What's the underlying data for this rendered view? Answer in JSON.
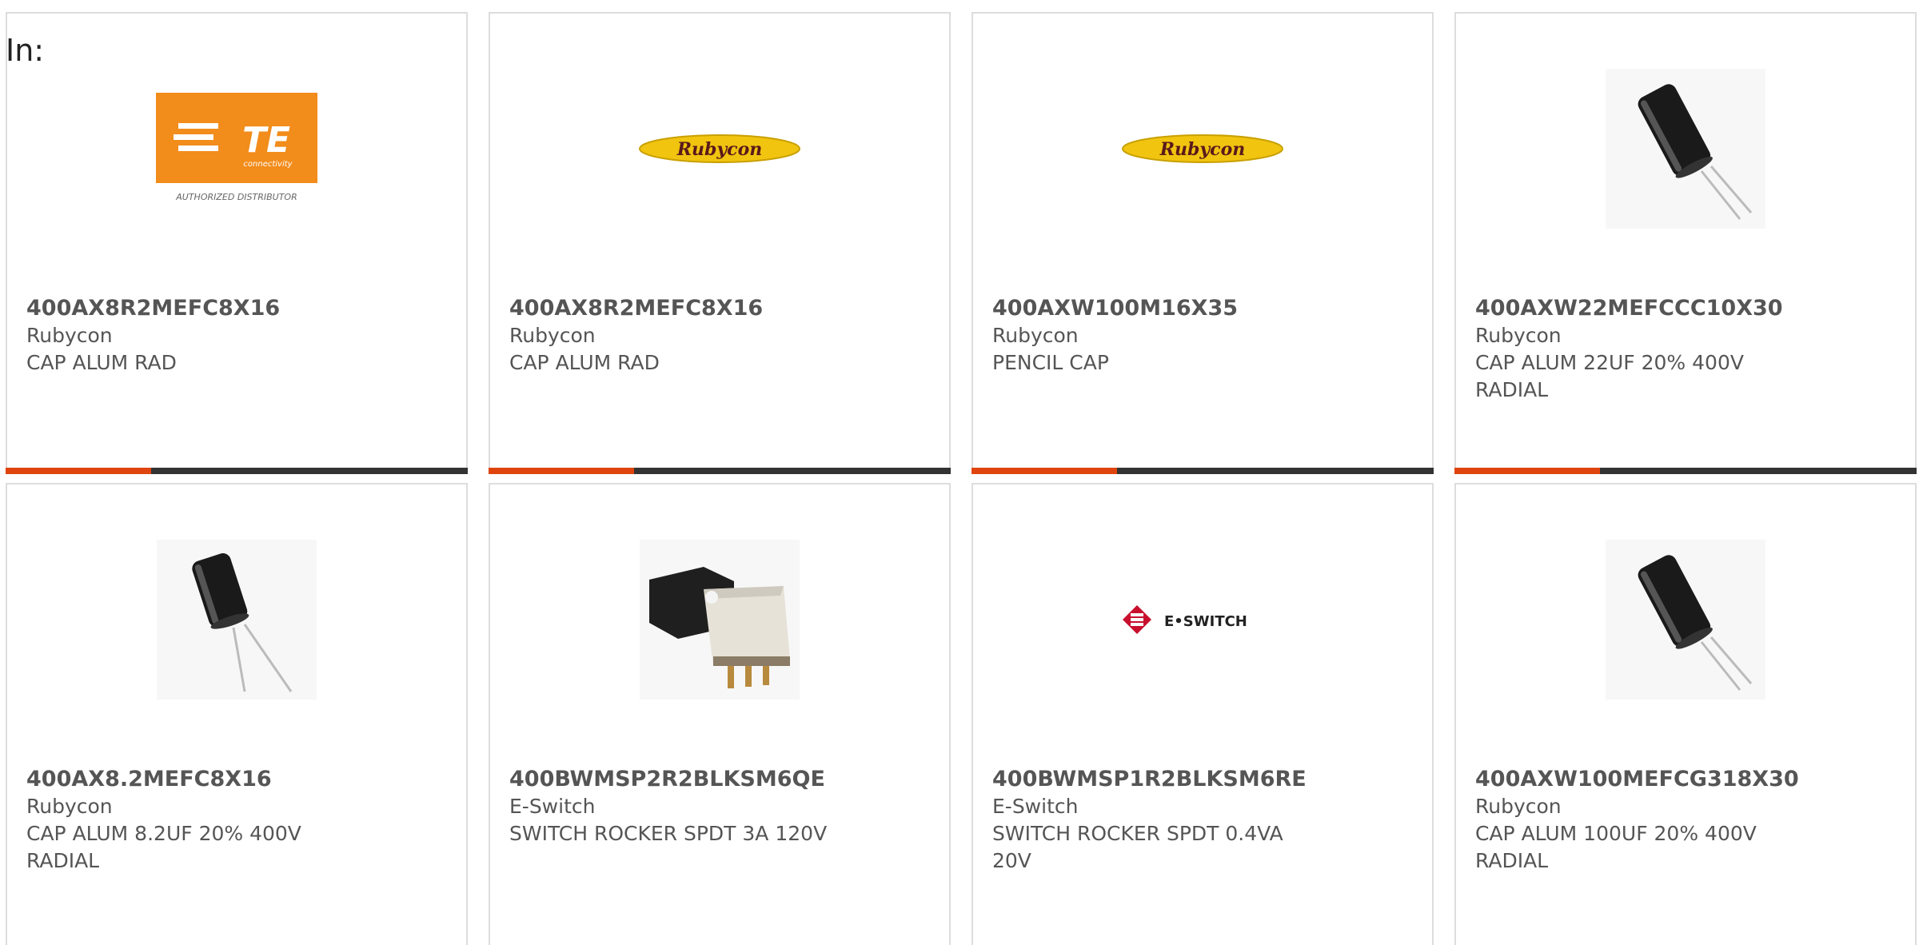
{
  "filter_label": "In:",
  "colors": {
    "accent": "#e0440e",
    "bar": "#333333",
    "text": "#555555",
    "te_orange": "#f28c1b",
    "rubycon_yellow": "#f1c40f",
    "eswitch_red": "#c8102e"
  },
  "products": [
    {
      "image": "te-logo-icon",
      "logo_text": "TE",
      "logo_sub": "connectivity",
      "logo_caption": "AUTHORIZED DISTRIBUTOR",
      "mpn": "400AX8R2MEFC8X16",
      "manufacturer": "Rubycon",
      "description": "CAP ALUM RAD"
    },
    {
      "image": "rubycon-logo-icon",
      "logo_text": "Rubycon",
      "mpn": "400AX8R2MEFC8X16",
      "manufacturer": "Rubycon",
      "description": "CAP ALUM RAD"
    },
    {
      "image": "rubycon-logo-icon",
      "logo_text": "Rubycon",
      "mpn": "400AXW100M16X35",
      "manufacturer": "Rubycon",
      "description": "PENCIL CAP"
    },
    {
      "image": "capacitor-icon",
      "mpn": "400AXW22MEFCCC10X30",
      "manufacturer": "Rubycon",
      "description": "CAP ALUM 22UF 20% 400V RADIAL"
    },
    {
      "image": "capacitor-icon",
      "mpn": "400AX8.2MEFC8X16",
      "manufacturer": "Rubycon",
      "description": "CAP ALUM 8.2UF 20% 400V RADIAL"
    },
    {
      "image": "rocker-switch-icon",
      "mpn": "400BWMSP2R2BLKSM6QE",
      "manufacturer": "E-Switch",
      "description": "SWITCH ROCKER SPDT 3A 120V"
    },
    {
      "image": "eswitch-logo-icon",
      "logo_text": "E•SWITCH",
      "mpn": "400BWMSP1R2BLKSM6RE",
      "manufacturer": "E-Switch",
      "description": "SWITCH ROCKER SPDT 0.4VA 20V"
    },
    {
      "image": "capacitor-icon",
      "mpn": "400AXW100MEFCG318X30",
      "manufacturer": "Rubycon",
      "description": "CAP ALUM 100UF 20% 400V RADIAL"
    }
  ]
}
